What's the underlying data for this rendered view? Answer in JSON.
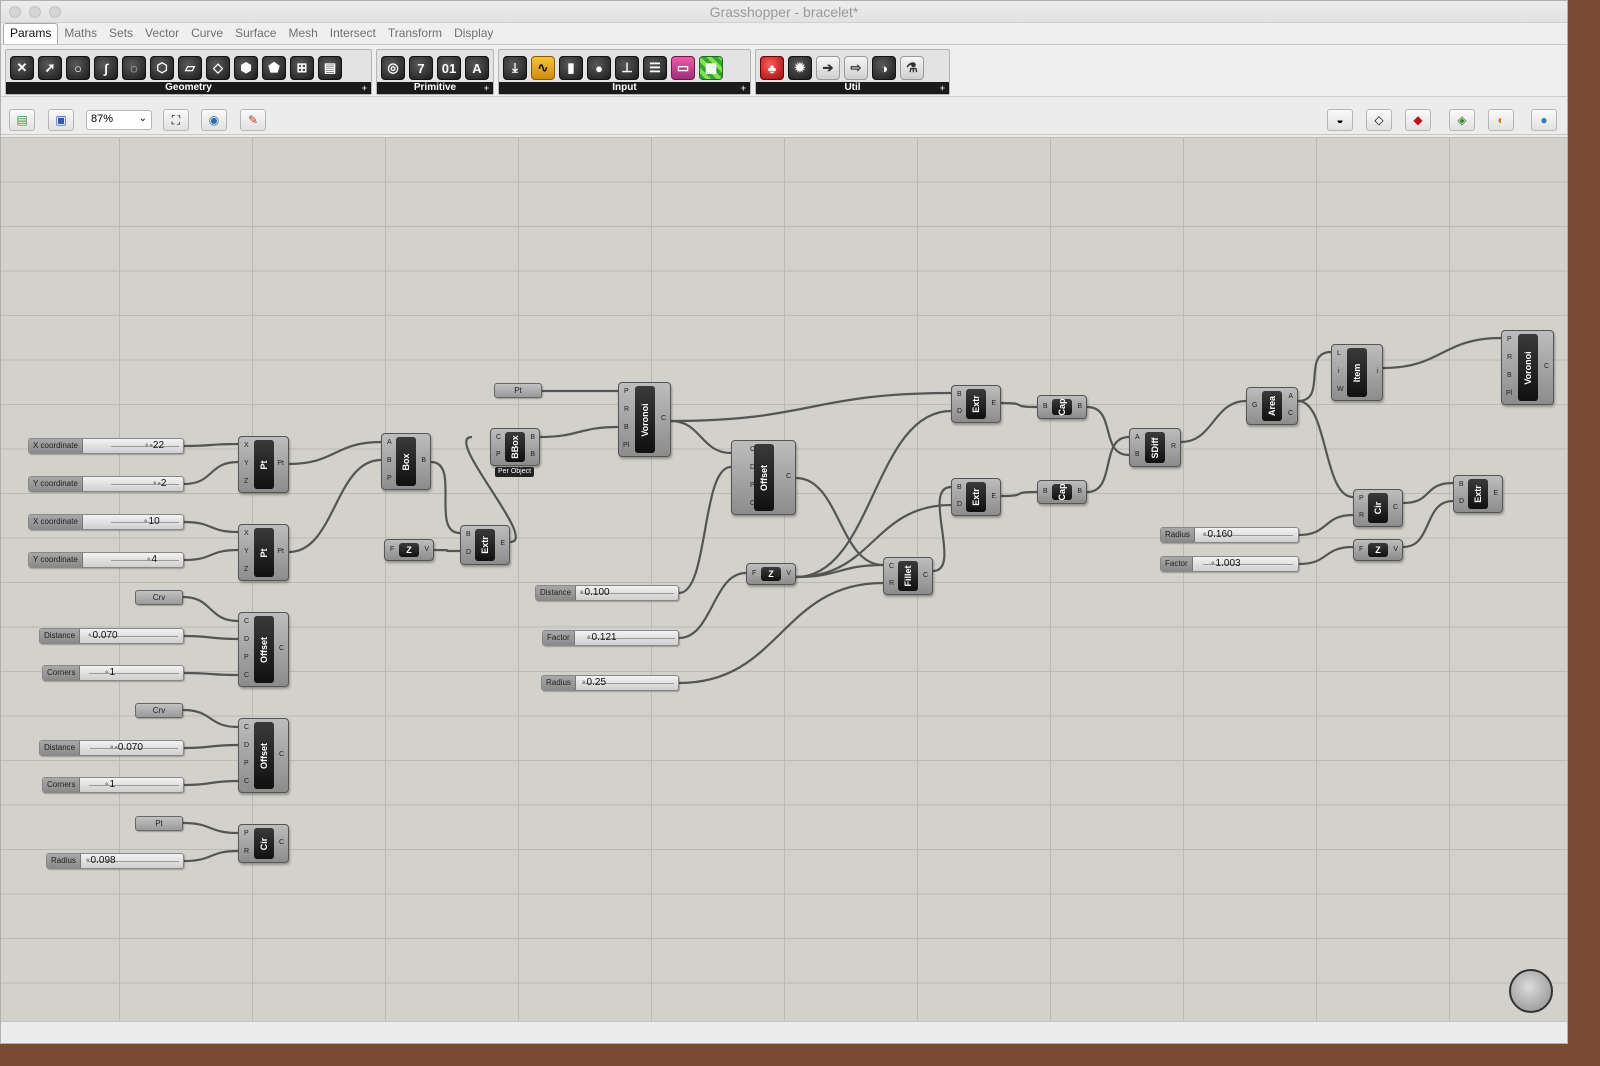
{
  "window": {
    "title": "Grasshopper - bracelet*"
  },
  "menu": [
    "Params",
    "Maths",
    "Sets",
    "Vector",
    "Curve",
    "Surface",
    "Mesh",
    "Intersect",
    "Transform",
    "Display"
  ],
  "ribbon": {
    "groups": [
      {
        "label": "Geometry",
        "icons": [
          "x-icon",
          "arrow-icon",
          "circle-icon",
          "curve-icon",
          "surface-icon",
          "brep-icon",
          "mesh-icon",
          "plane-icon",
          "box-icon",
          "facet-icon",
          "grid-icon",
          "field-icon"
        ]
      },
      {
        "label": "Primitive",
        "icons": [
          "circle-param-icon",
          "number-icon",
          "boolean-icon",
          "text-icon"
        ]
      },
      {
        "label": "Input",
        "icons": [
          "download-icon",
          "waveform-icon",
          "file-icon",
          "button-icon",
          "slider-icon",
          "list-icon",
          "gradient-icon",
          "checker-icon"
        ]
      },
      {
        "label": "Util",
        "icons": [
          "cherries-icon",
          "tree-icon",
          "arrow-right-icon",
          "arrow-outline-icon",
          "data-icon",
          "flask-icon"
        ]
      }
    ],
    "glyphs": {
      "number-icon": "7",
      "boolean-icon": "01",
      "text-icon": "A"
    }
  },
  "toolbar": {
    "zoom": "87%"
  },
  "sliders": [
    {
      "name": "X coordinate",
      "value": "-22"
    },
    {
      "name": "Y coordinate",
      "value": "-2"
    },
    {
      "name": "X coordinate",
      "value": "10"
    },
    {
      "name": "Y coordinate",
      "value": "4"
    },
    {
      "name": "Distance",
      "value": "0.070"
    },
    {
      "name": "Corners",
      "value": "1"
    },
    {
      "name": "Distance",
      "value": "-0.070"
    },
    {
      "name": "Corners",
      "value": "1"
    },
    {
      "name": "Radius",
      "value": "0.098"
    },
    {
      "name": "Distance",
      "value": "0.100"
    },
    {
      "name": "Factor",
      "value": "0.121"
    },
    {
      "name": "Radius",
      "value": "0.25"
    },
    {
      "name": "Radius",
      "value": "0.160"
    },
    {
      "name": "Factor",
      "value": "1.003"
    }
  ],
  "params": [
    "Crv",
    "Crv",
    "Pt",
    "Pt"
  ],
  "components": [
    {
      "label": "Pt",
      "inputs": [
        "X",
        "Y",
        "Z"
      ],
      "outputs": [
        "Pt"
      ]
    },
    {
      "label": "Pt",
      "inputs": [
        "X",
        "Y",
        "Z"
      ],
      "outputs": [
        "Pt"
      ]
    },
    {
      "label": "Offset",
      "inputs": [
        "C",
        "D",
        "P",
        "C"
      ],
      "outputs": [
        "C"
      ]
    },
    {
      "label": "Offset",
      "inputs": [
        "C",
        "D",
        "P",
        "C"
      ],
      "outputs": [
        "C"
      ]
    },
    {
      "label": "Cir",
      "inputs": [
        "P",
        "R"
      ],
      "outputs": [
        "C"
      ]
    },
    {
      "label": "Box",
      "inputs": [
        "A",
        "B",
        "P"
      ],
      "outputs": [
        "B"
      ]
    },
    {
      "label": "Z",
      "inputs": [
        "F"
      ],
      "outputs": [
        "V"
      ]
    },
    {
      "label": "Extr",
      "inputs": [
        "B",
        "D"
      ],
      "outputs": [
        "E"
      ]
    },
    {
      "label": "BBox",
      "inputs": [
        "C",
        "P"
      ],
      "outputs": [
        "B",
        "B"
      ],
      "tag": "Per Object"
    },
    {
      "label": "Voronoi",
      "inputs": [
        "P",
        "R",
        "B",
        "Pl"
      ],
      "outputs": [
        "C"
      ]
    },
    {
      "label": "Offset",
      "inputs": [
        "C",
        "D",
        "P",
        "C"
      ],
      "outputs": [
        "C"
      ]
    },
    {
      "label": "Z",
      "inputs": [
        "F"
      ],
      "outputs": [
        "V"
      ]
    },
    {
      "label": "Fillet",
      "inputs": [
        "C",
        "R"
      ],
      "outputs": [
        "C"
      ]
    },
    {
      "label": "Extr",
      "inputs": [
        "B",
        "D"
      ],
      "outputs": [
        "E"
      ]
    },
    {
      "label": "Extr",
      "inputs": [
        "B",
        "D"
      ],
      "outputs": [
        "E"
      ]
    },
    {
      "label": "Cap",
      "inputs": [
        "B"
      ],
      "outputs": [
        "B"
      ]
    },
    {
      "label": "Cap",
      "inputs": [
        "B"
      ],
      "outputs": [
        "B"
      ]
    },
    {
      "label": "SDiff",
      "inputs": [
        "A",
        "B"
      ],
      "outputs": [
        "R"
      ]
    },
    {
      "label": "Area",
      "inputs": [
        "G"
      ],
      "outputs": [
        "A",
        "C"
      ]
    },
    {
      "label": "Item",
      "inputs": [
        "L",
        "i",
        "W"
      ],
      "outputs": [
        "i"
      ]
    },
    {
      "label": "Voronoi",
      "inputs": [
        "P",
        "R",
        "B",
        "Pl"
      ],
      "outputs": [
        "C"
      ]
    },
    {
      "label": "Cir",
      "inputs": [
        "P",
        "R"
      ],
      "outputs": [
        "C"
      ]
    },
    {
      "label": "Z",
      "inputs": [
        "F"
      ],
      "outputs": [
        "V"
      ]
    },
    {
      "label": "Extr",
      "inputs": [
        "B",
        "D"
      ],
      "outputs": [
        "E"
      ]
    }
  ]
}
